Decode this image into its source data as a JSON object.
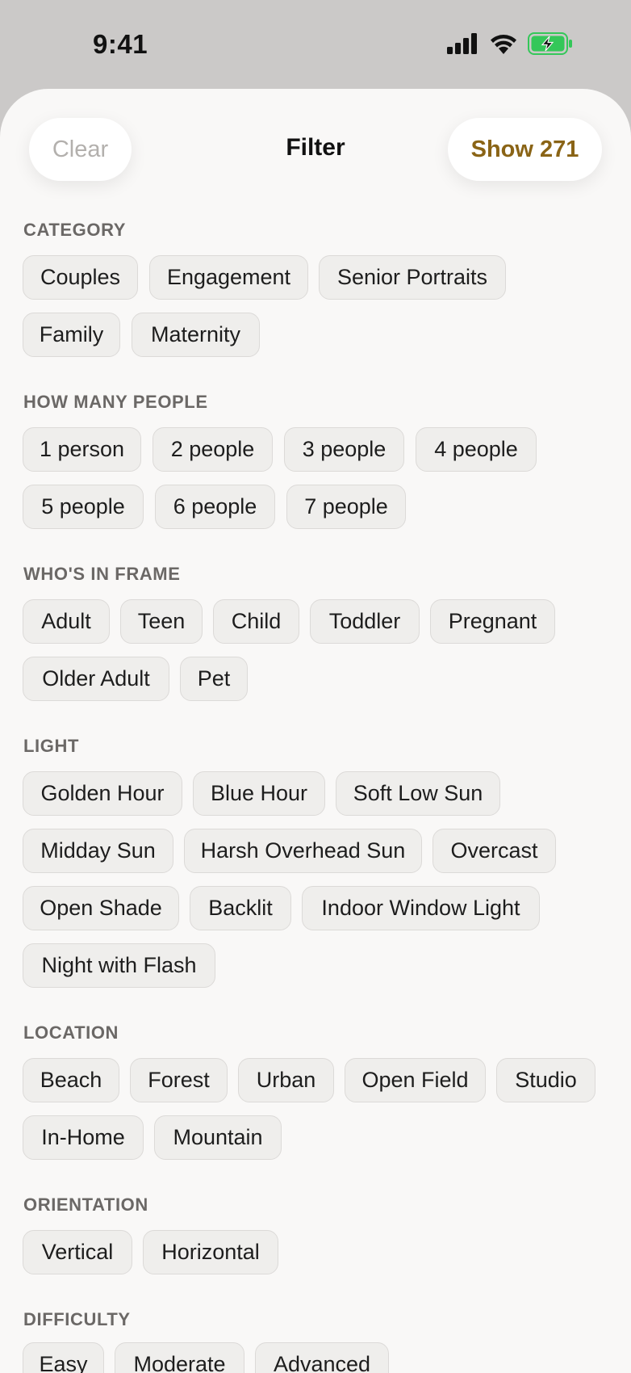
{
  "status_bar": {
    "time": "9:41"
  },
  "header": {
    "clear_label": "Clear",
    "title": "Filter",
    "show_label": "Show 271"
  },
  "sections": [
    {
      "label": "CATEGORY",
      "chips": [
        "Couples",
        "Engagement",
        "Senior Portraits",
        "Family",
        "Maternity"
      ]
    },
    {
      "label": "HOW MANY PEOPLE",
      "chips": [
        "1 person",
        "2 people",
        "3 people",
        "4 people",
        "5 people",
        "6 people",
        "7 people"
      ]
    },
    {
      "label": "WHO'S IN FRAME",
      "chips": [
        "Adult",
        "Teen",
        "Child",
        "Toddler",
        "Pregnant",
        "Older Adult",
        "Pet"
      ]
    },
    {
      "label": "LIGHT",
      "chips": [
        "Golden Hour",
        "Blue Hour",
        "Soft Low Sun",
        "Midday Sun",
        "Harsh Overhead Sun",
        "Overcast",
        "Open Shade",
        "Backlit",
        "Indoor Window Light",
        "Night with Flash"
      ]
    },
    {
      "label": "LOCATION",
      "chips": [
        "Beach",
        "Forest",
        "Urban",
        "Open Field",
        "Studio",
        "In-Home",
        "Mountain"
      ]
    },
    {
      "label": "ORIENTATION",
      "chips": [
        "Vertical",
        "Horizontal"
      ]
    },
    {
      "label": "DIFFICULTY",
      "chips": [
        "Easy",
        "Moderate",
        "Advanced"
      ]
    }
  ],
  "colors": {
    "accent": "#8a6416",
    "chip_bg": "#efeeec",
    "sheet_bg": "#f9f8f7",
    "battery_fill": "#34c759"
  }
}
